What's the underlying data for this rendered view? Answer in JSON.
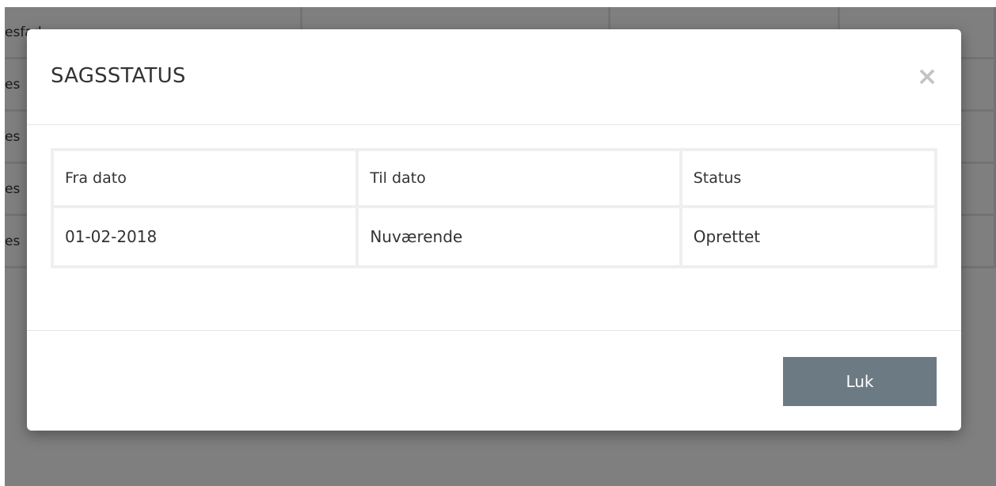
{
  "background": {
    "rows": [
      {
        "text": "esfad..."
      },
      {
        "text": "es"
      },
      {
        "text": "es"
      },
      {
        "text": "es"
      },
      {
        "text": "es"
      }
    ]
  },
  "modal": {
    "title": "SAGSSTATUS",
    "close_icon": "close-icon",
    "table": {
      "headers": [
        "Fra dato",
        "Til dato",
        "Status"
      ],
      "rows": [
        [
          "01-02-2018",
          "Nuværende",
          "Oprettet"
        ]
      ]
    },
    "footer": {
      "close_label": "Luk"
    }
  },
  "colors": {
    "backdrop": "rgba(0,0,0,0.5)",
    "button_bg": "#6c7a83",
    "close_icon": "#c4c4c4"
  }
}
